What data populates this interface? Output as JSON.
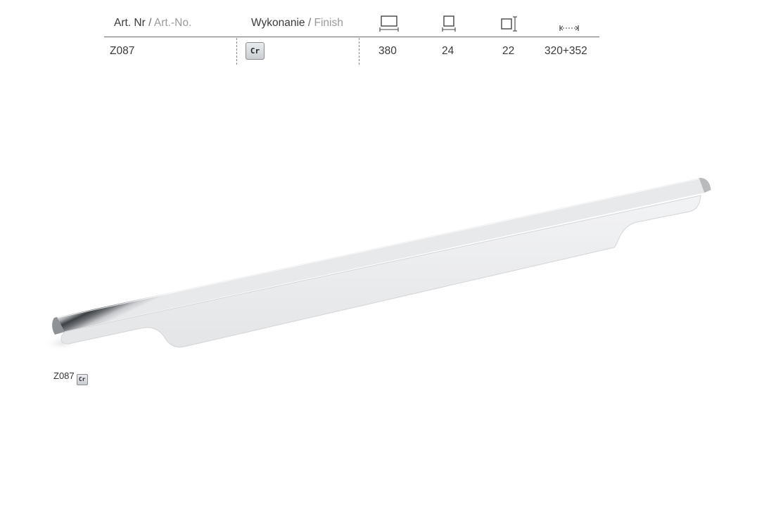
{
  "table": {
    "header": {
      "article_label_pl": "Art. Nr",
      "article_label_en": "Art.-No.",
      "finish_label_pl": "Wykonanie",
      "finish_label_en": "Finish",
      "separator": "/",
      "column_icons": [
        "length-icon",
        "height-icon",
        "depth-icon",
        "hole-spacing-icon"
      ]
    },
    "row": {
      "article": "Z087",
      "finish_code": "Cr",
      "length": "380",
      "height": "24",
      "depth": "22",
      "hole_spacing": "320+352"
    }
  },
  "caption": {
    "article": "Z087",
    "finish_code": "Cr"
  },
  "colors": {
    "rule": "#6f6f6f",
    "muted_text": "#9a9a9a",
    "badge_fill": "#d4d8dc"
  }
}
